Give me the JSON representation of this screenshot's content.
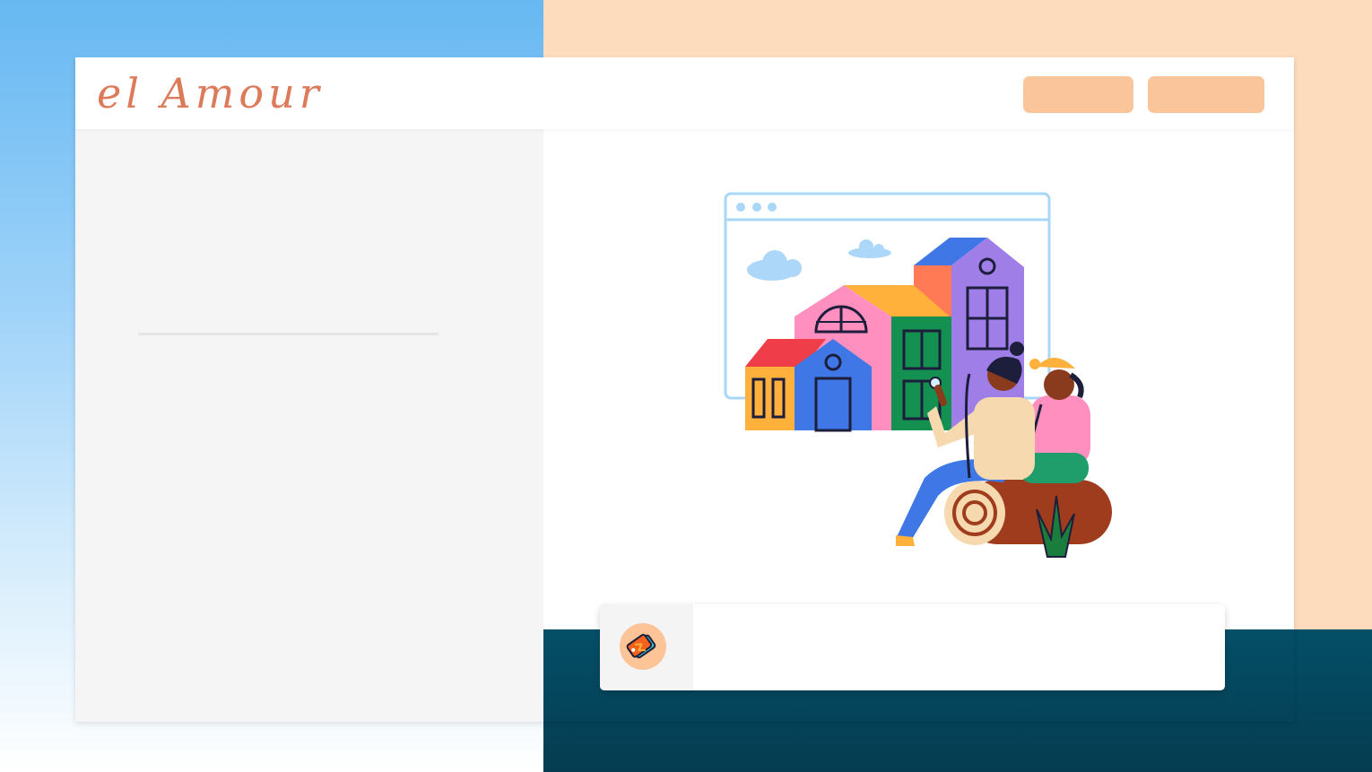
{
  "header": {
    "brand": "el Amour",
    "nav_buttons": [
      {
        "label": ""
      },
      {
        "label": ""
      }
    ]
  },
  "card": {
    "icon": "price-tag-icon",
    "text": ""
  },
  "illustration": {
    "subject": "people-sitting-on-log-with-houses-browser-icon"
  },
  "colors": {
    "brand_text": "#dd7a5a",
    "button_fill": "#fbc59b",
    "bg_blue": "#67b8f2",
    "bg_peach": "#fddbbd",
    "bg_teal": "#044f67"
  }
}
